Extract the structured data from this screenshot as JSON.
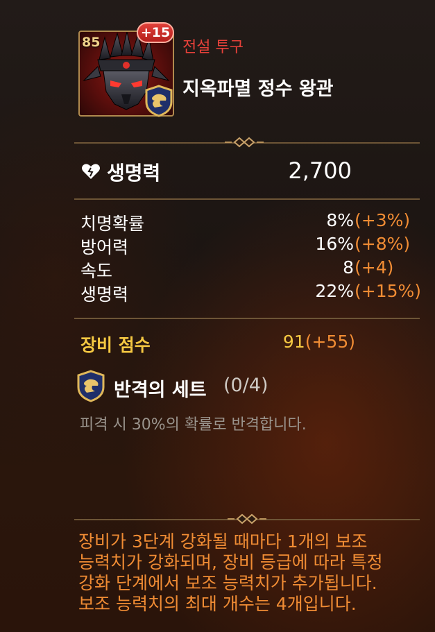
{
  "item": {
    "level": "85",
    "enhance": "+15",
    "grade": "전설 투구",
    "name": "지옥파멸 정수 왕관"
  },
  "main_stat": {
    "icon": "heart-icon",
    "label": "생명력",
    "value": "2,700"
  },
  "sub_stats": [
    {
      "label": "치명확률",
      "value": "8%",
      "bonus": "(+3%)"
    },
    {
      "label": "방어력",
      "value": "16%",
      "bonus": "(+8%)"
    },
    {
      "label": "속도",
      "value": "8",
      "bonus": "(+4)"
    },
    {
      "label": "생명력",
      "value": "22%",
      "bonus": "(+15%)"
    }
  ],
  "score": {
    "label": "장비 점수",
    "value": "91",
    "bonus": "(+55)"
  },
  "set": {
    "icon": "counterattack-set-icon",
    "title": "반격의 세트",
    "count": "(0/4)",
    "description": "피격 시 30%의 확률로 반격합니다."
  },
  "footer_note": [
    "장비가 3단계 강화될 때마다 1개의 보조",
    "능력치가 강화되며, 장비 등급에 따라 특정",
    "강화 단계에서 보조 능력치가 추가됩니다.",
    "보조 능력치의 최대 개수는 4개입니다."
  ],
  "colors": {
    "grade": "#e7413a",
    "bonus": "#f08c34",
    "score": "#f5c842",
    "divider": "#6d5536"
  }
}
